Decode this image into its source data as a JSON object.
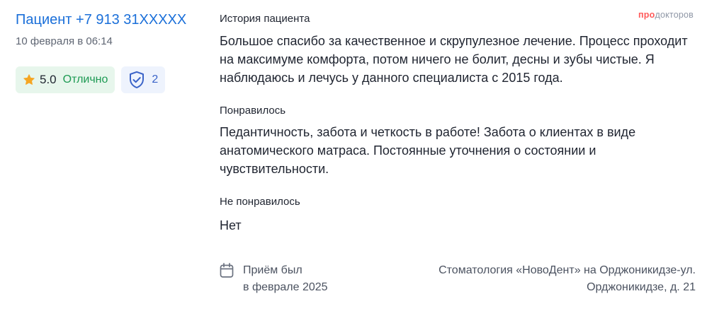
{
  "review": {
    "author": "Пациент +7 913 31XXXXX",
    "date": "10 февраля в 06:14",
    "rating": {
      "value": "5.0",
      "label": "Отлично",
      "icon": "star-icon",
      "accent": "#1d9a53"
    },
    "verifications": {
      "icon": "shield-check-icon",
      "count": "2"
    }
  },
  "logo": {
    "part1": "про",
    "part2": "докторов"
  },
  "sections": [
    {
      "title": "История пациента",
      "text": "Большое спасибо за качественное и скрупулезное лечение. Процесс проходит на максимуме комфорта, потом ничего не болит, десны и зубы чистые. Я наблюдаюсь и лечусь у данного специалиста с 2015 года."
    },
    {
      "title": "Понравилось",
      "text": "Педантичность, забота и четкость в работе! Забота о клиентах в виде анатомического матраса. Постоянные уточнения о состоянии и чувствительности."
    },
    {
      "title": "Не понравилось",
      "text": "Нет"
    }
  ],
  "footer": {
    "visit_line1": "Приём был",
    "visit_line2": "в феврале 2025",
    "clinic_line1": "Стоматология «НовоДент» на Орджоникидзе-ул.",
    "clinic_line2": "Орджоникидзе, д. 21",
    "icon": "calendar-icon"
  },
  "colors": {
    "link": "#1a6fd9",
    "rating_bg": "#e7f6ec",
    "verified_bg": "#eef3fd",
    "star": "#f5a623"
  }
}
